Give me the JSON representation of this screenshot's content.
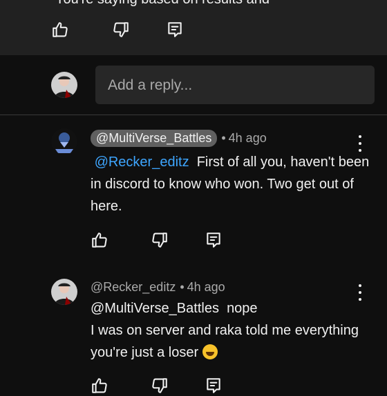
{
  "top_comment": {
    "cut_text": "You're saying based on results and"
  },
  "reply_input": {
    "placeholder": "Add a reply..."
  },
  "replies": [
    {
      "author": "@MultiVerse_Battles",
      "time": "4h ago",
      "mention": "@Recker_editz",
      "text": "First of all you, haven't been in discord to know who won. Two get out of here."
    },
    {
      "author": "@Recker_editz",
      "time": "4h ago",
      "mention": "@MultiVerse_Battles",
      "text_1": "nope",
      "text_2": "I was on server and raka told me everything you're just a loser"
    }
  ],
  "icons": {
    "like": "thumbs-up-icon",
    "dislike": "thumbs-down-icon",
    "reply": "comment-reply-icon",
    "more": "more-vertical-icon",
    "laugh": "rolling-laughing-emoji-icon"
  },
  "colors": {
    "background": "#0f0f0f",
    "panel": "#212121",
    "mention": "#3ea6ff",
    "muted": "#aaaaaa"
  },
  "separator_dot": "•"
}
